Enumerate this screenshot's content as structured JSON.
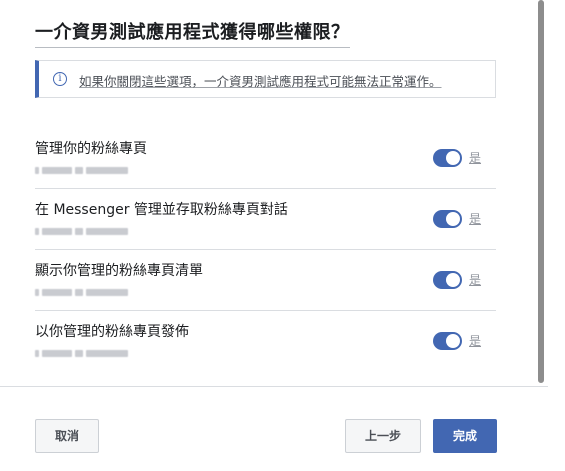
{
  "dialog": {
    "title": "一介資男測試應用程式獲得哪些權限？",
    "notice": {
      "icon": "info-icon",
      "text": "如果你關閉這些選項，一介資男測試應用程式可能無法正常運作。"
    },
    "permissions": [
      {
        "title": "管理你的粉絲專頁",
        "toggle_label": "是",
        "enabled": true
      },
      {
        "title": "在 Messenger 管理並存取粉絲專頁對話",
        "toggle_label": "是",
        "enabled": true
      },
      {
        "title": "顯示你管理的粉絲專頁清單",
        "toggle_label": "是",
        "enabled": true
      },
      {
        "title": "以你管理的粉絲專頁發佈",
        "toggle_label": "是",
        "enabled": true
      }
    ],
    "footer": {
      "cancel_label": "取消",
      "back_label": "上一步",
      "done_label": "完成"
    },
    "colors": {
      "accent": "#4267b2",
      "border": "#dadde1"
    }
  }
}
